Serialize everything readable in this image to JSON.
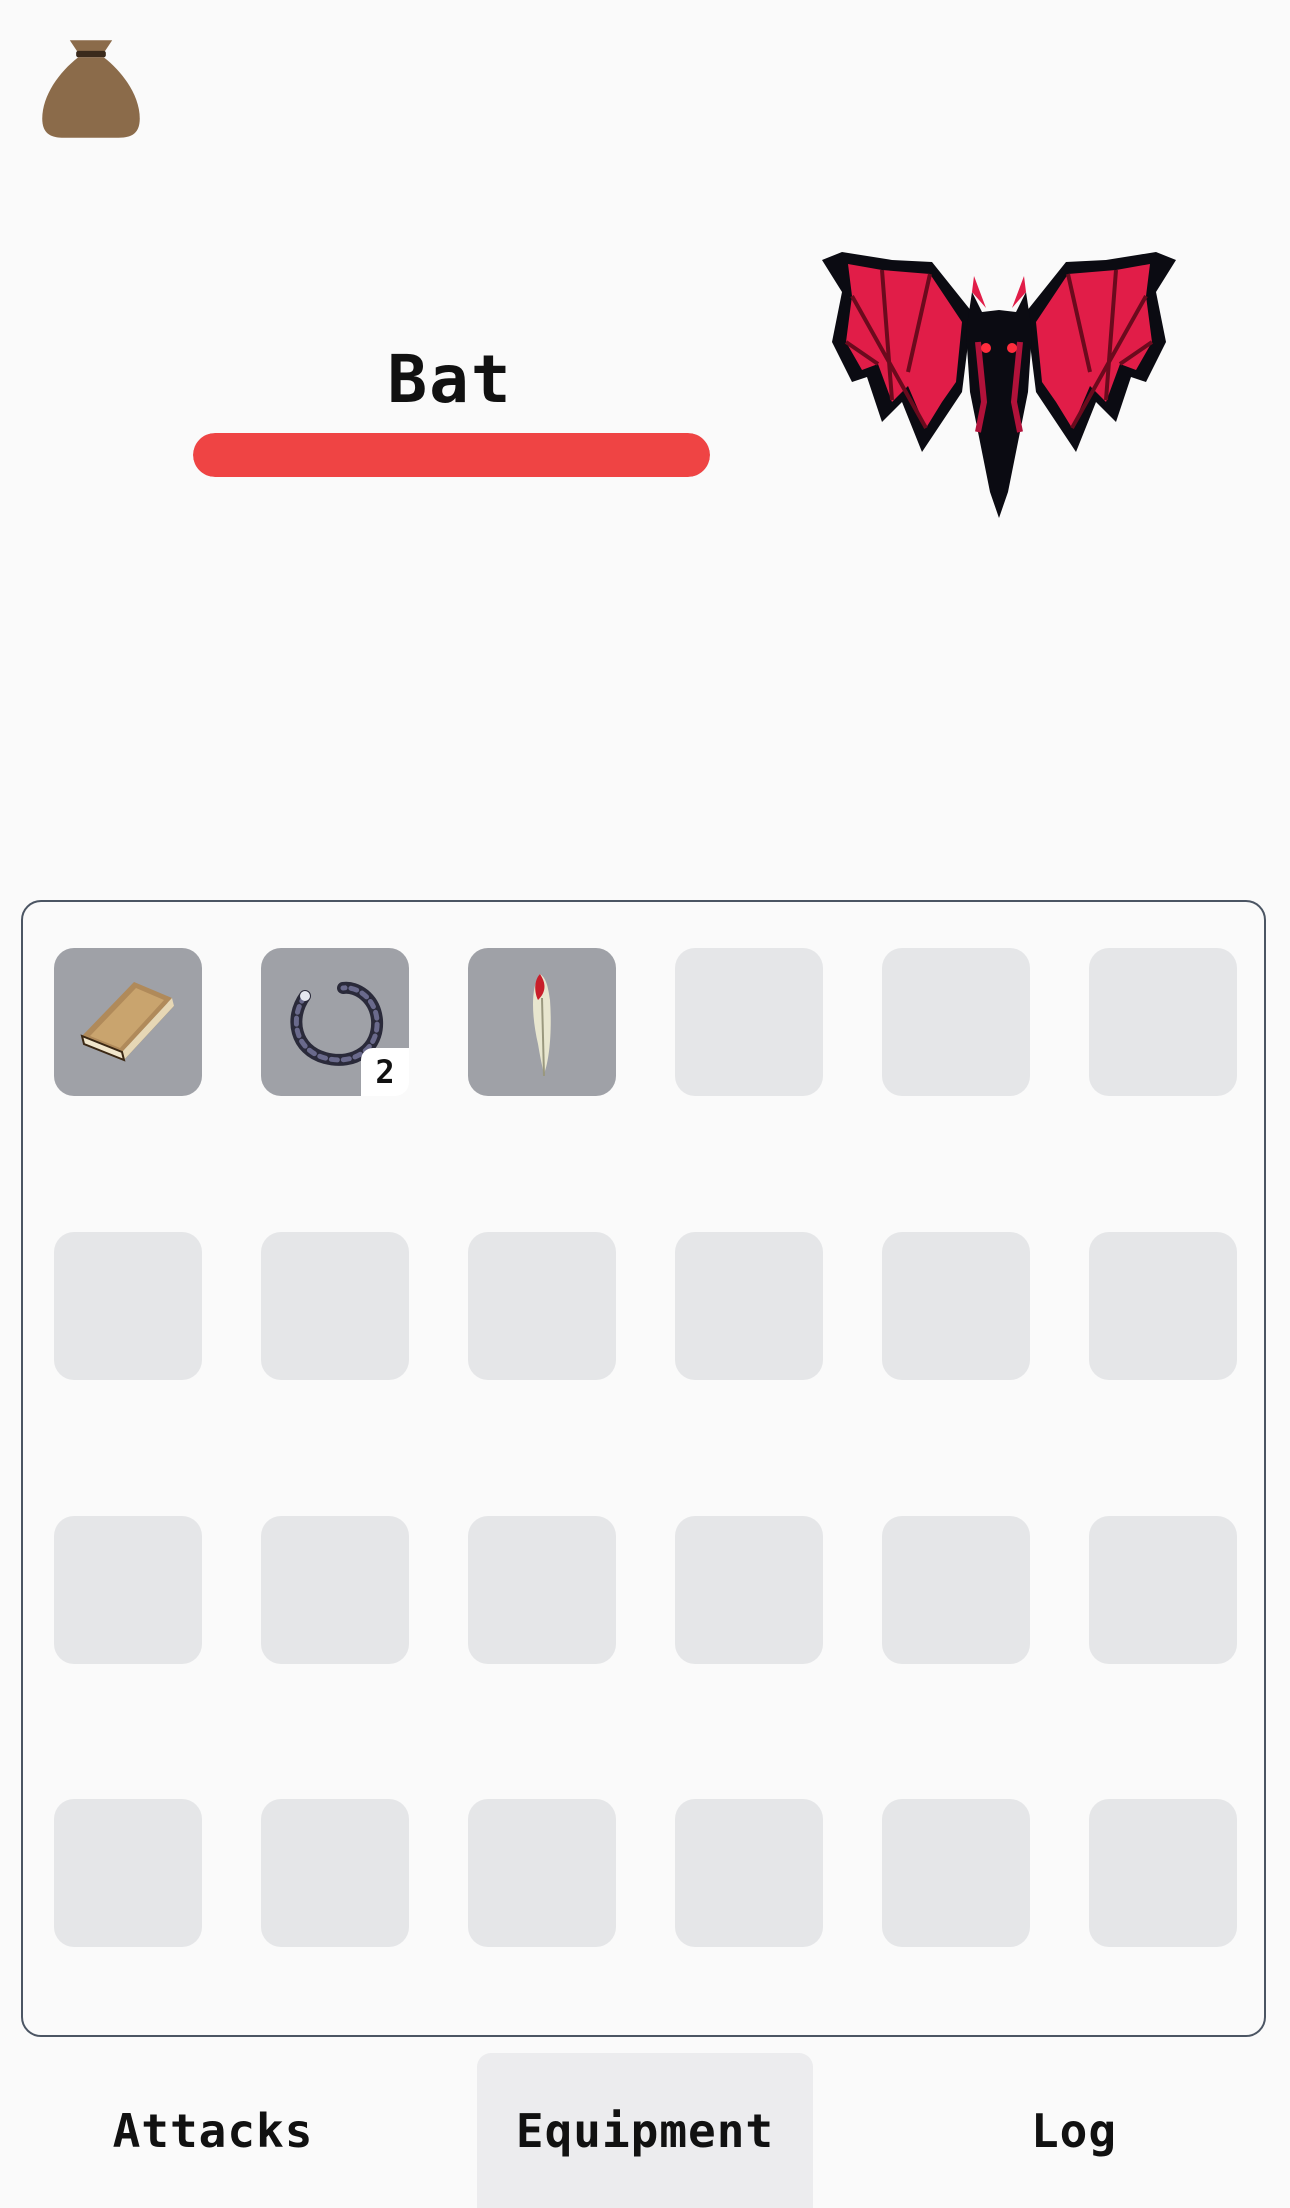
{
  "header": {
    "bag_icon": "loot-bag-icon"
  },
  "enemy": {
    "name": "Bat",
    "health_fraction": 1.0,
    "health_color": "#ef4444",
    "image": "bat-sprite"
  },
  "inventory": {
    "slots": [
      {
        "item": "book-icon",
        "quantity": null
      },
      {
        "item": "ring-icon",
        "quantity": "2"
      },
      {
        "item": "feather-icon",
        "quantity": null
      },
      {
        "item": null
      },
      {
        "item": null
      },
      {
        "item": null
      },
      {
        "item": null
      },
      {
        "item": null
      },
      {
        "item": null
      },
      {
        "item": null
      },
      {
        "item": null
      },
      {
        "item": null
      },
      {
        "item": null
      },
      {
        "item": null
      },
      {
        "item": null
      },
      {
        "item": null
      },
      {
        "item": null
      },
      {
        "item": null
      },
      {
        "item": null
      },
      {
        "item": null
      },
      {
        "item": null
      },
      {
        "item": null
      },
      {
        "item": null
      },
      {
        "item": null
      }
    ]
  },
  "tabs": [
    {
      "label": "Attacks",
      "active": false
    },
    {
      "label": "Equipment",
      "active": true
    },
    {
      "label": "Log",
      "active": false
    }
  ]
}
